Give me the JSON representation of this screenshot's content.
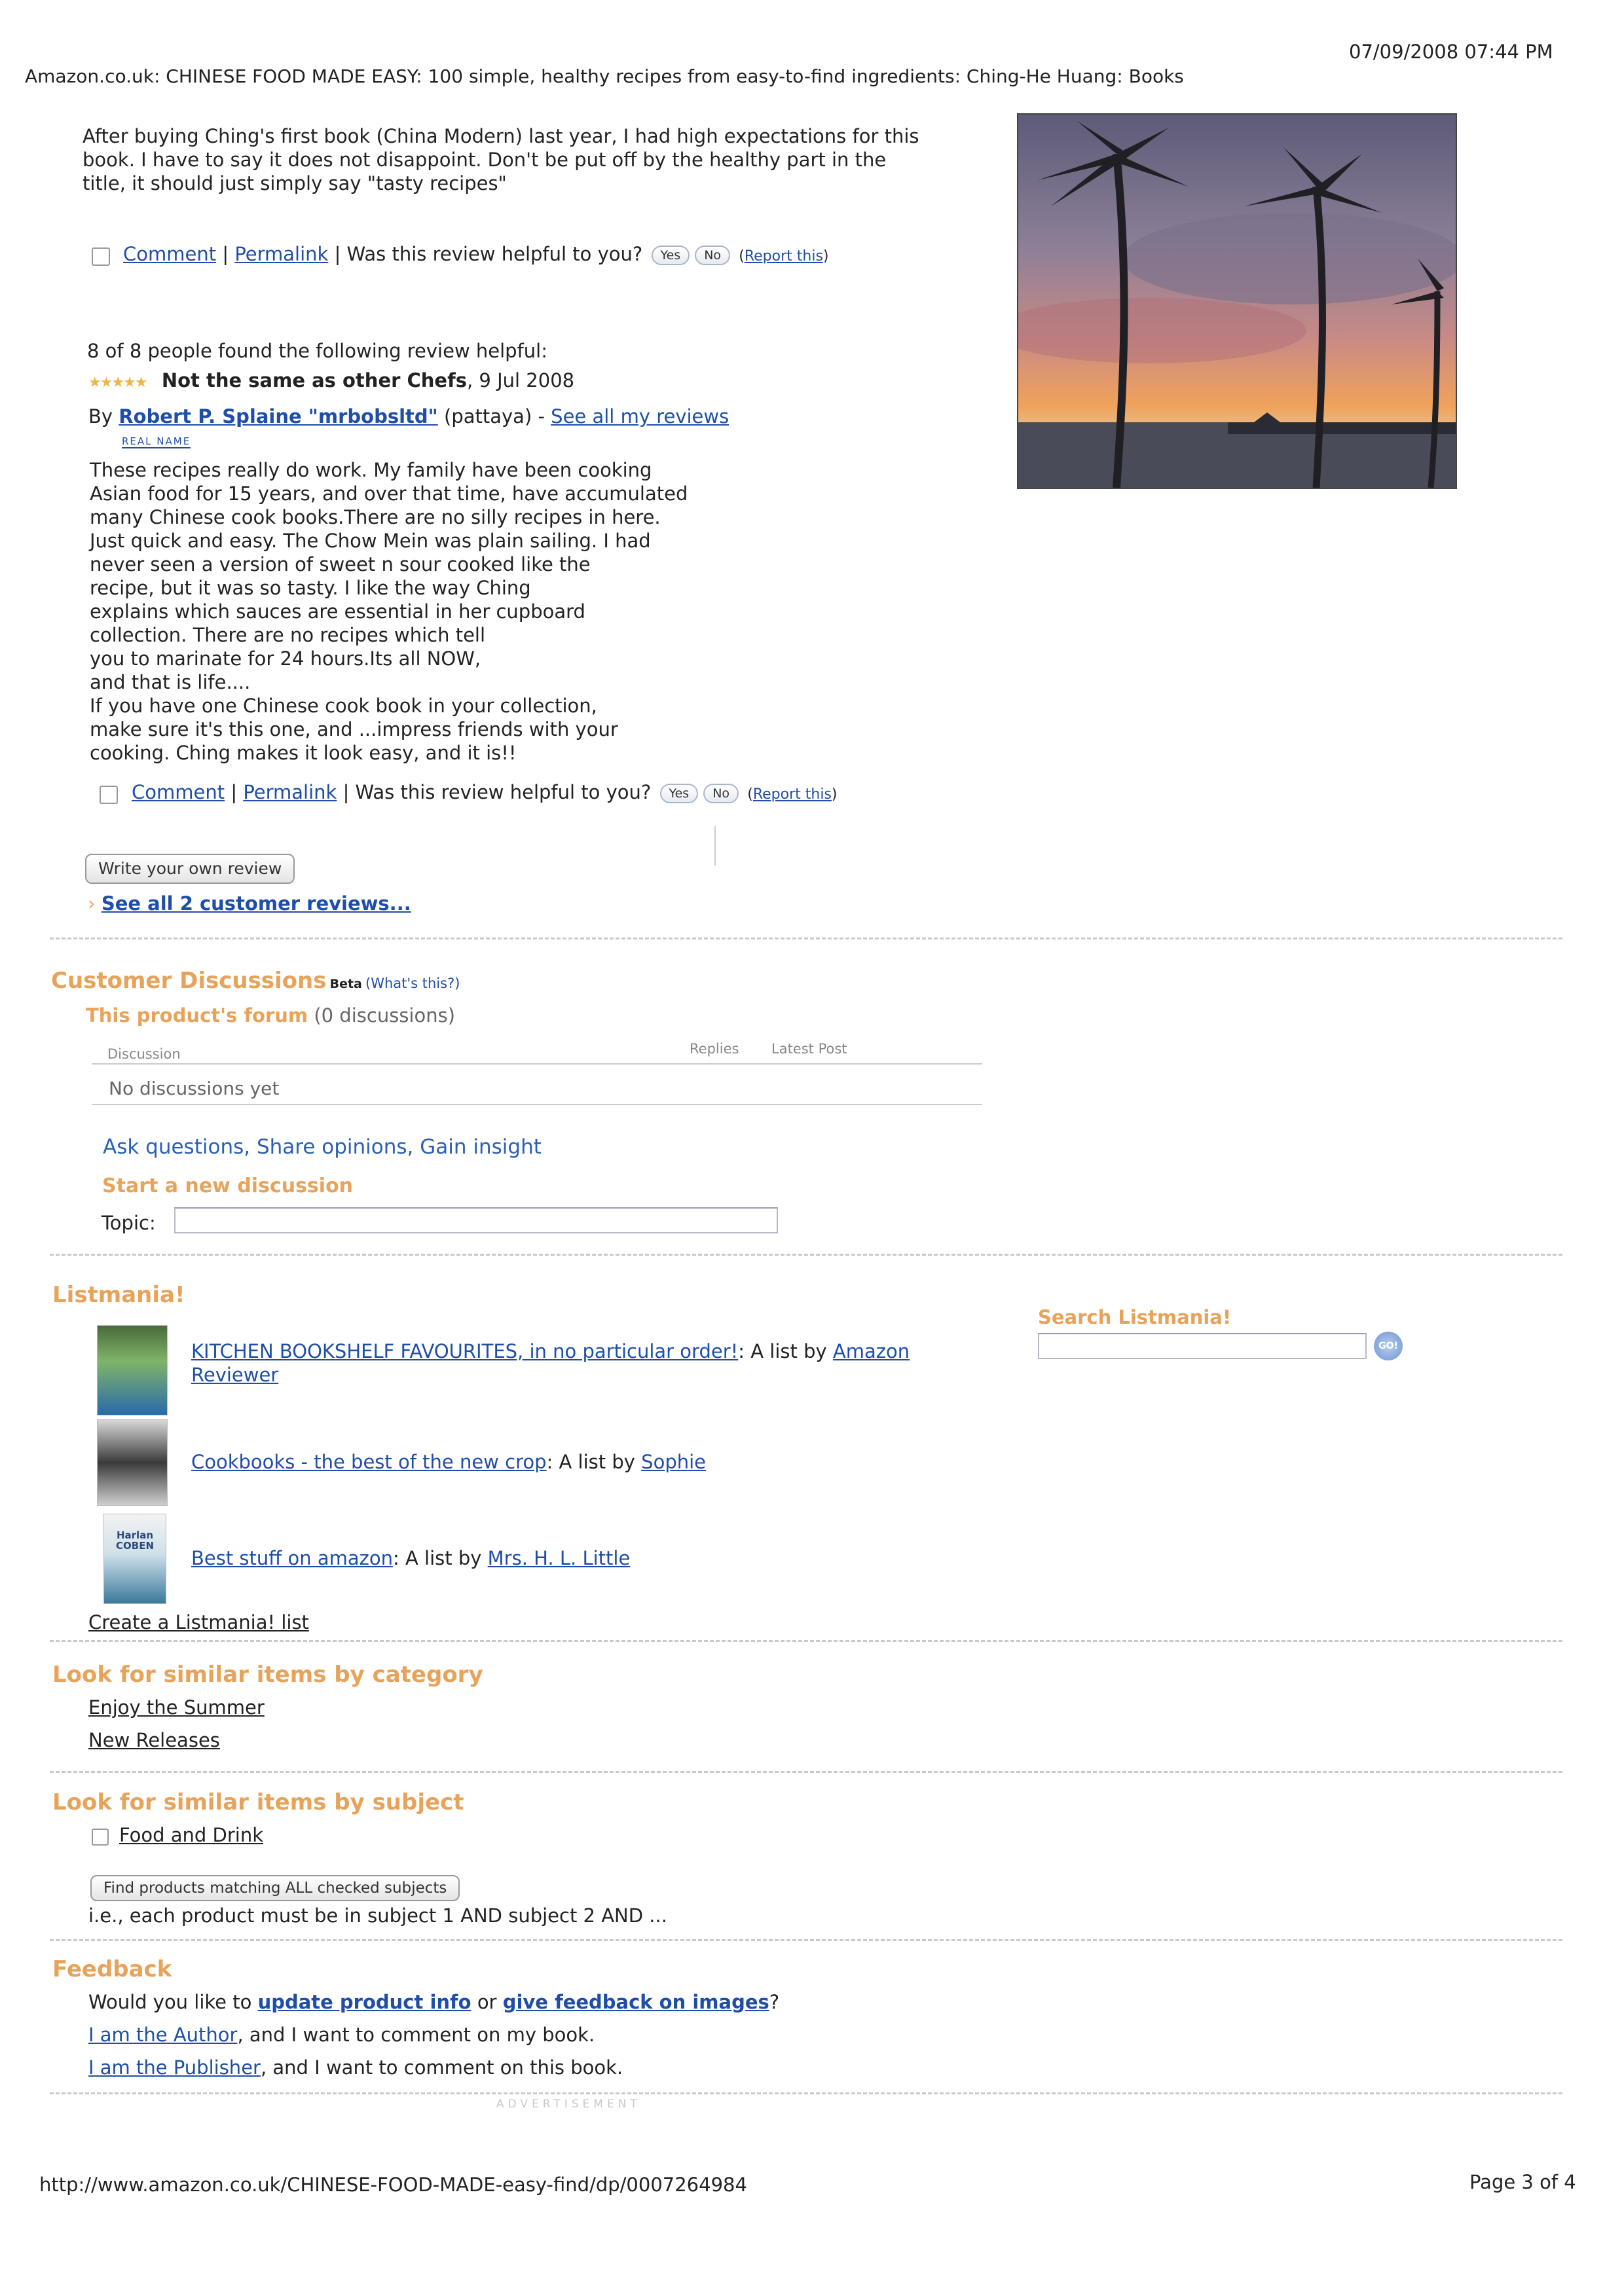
{
  "header": {
    "title": "Amazon.co.uk: CHINESE FOOD MADE EASY: 100 simple, healthy recipes from easy-to-find ingredients: Ching-He Huang: Books",
    "datetime": "07/09/2008 07:44 PM"
  },
  "review1": {
    "text_lines": [
      "After buying Ching's first book (China Modern) last year, I had high expectations for this",
      "book. I have to say it does not disappoint. Don't be put off by the healthy part in the",
      "title, it should just simply say \"tasty recipes\""
    ],
    "comment": "Comment",
    "sep1": "|",
    "permalink": "Permalink",
    "question": "| Was this review helpful to you?",
    "yes": "Yes",
    "no": "No",
    "report_open": "(",
    "report": "Report this",
    "report_close": ")"
  },
  "review2": {
    "helpful": "8 of 8 people found the following review helpful:",
    "stars": "★★★★★",
    "title": "Not the same as other Chefs",
    "date": ", 9 Jul 2008",
    "by": "By",
    "author": "Robert P. Splaine \"mrbobsltd\"",
    "location": "(pattaya) -",
    "see_all": "See all my reviews",
    "real_name": "REAL NAME",
    "text_lines": [
      "These recipes really do work. My family have been cooking",
      "Asian food for 15 years, and over that time, have accumulated",
      "many Chinese cook books.There are no silly recipes in here.",
      "Just quick and easy. The Chow Mein was plain sailing. I had",
      "never seen a version of sweet n sour cooked like the",
      "recipe, but it was so tasty. I like the way Ching",
      "explains which sauces are essential in her cupboard",
      "collection. There are no recipes which tell",
      "you to marinate for 24 hours.Its all NOW,",
      "and that is life....",
      "If you have one Chinese cook book in your collection,",
      "make sure it's this one, and ...impress friends with your",
      "cooking. Ching makes it look easy, and it is!!"
    ],
    "comment": "Comment",
    "sep1": "|",
    "permalink": "Permalink",
    "question": "| Was this review helpful to you?",
    "yes": "Yes",
    "no": "No",
    "report_open": "(",
    "report": "Report this",
    "report_close": ")"
  },
  "write_review": "Write your own review",
  "see_all_reviews_arrow": "›",
  "see_all_reviews": "See all 2 customer reviews...",
  "discussions": {
    "heading": "Customer Discussions",
    "beta": "Beta",
    "whats_this_open": "(",
    "whats_this": "What's this?",
    "whats_this_close": ")",
    "forum": "This product's forum",
    "forum_count": "(0 discussions)",
    "col_discussion": "Discussion",
    "col_replies": "Replies",
    "col_latest": "Latest Post",
    "empty": "No discussions yet",
    "ask": "Ask questions, Share opinions, Gain insight",
    "start": "Start a new discussion",
    "topic_label": "Topic:"
  },
  "listmania": {
    "heading": "Listmania!",
    "search_heading": "Search Listmania!",
    "go": "GO!",
    "lists": [
      {
        "title": "KITCHEN BOOKSHELF FAVOURITES, in no particular order!",
        "by": ": A list by",
        "author": "Amazon",
        "author2": "Reviewer"
      },
      {
        "title": "Cookbooks - the best of the new crop",
        "by": ": A list by",
        "author": "Sophie"
      },
      {
        "title": "Best stuff on amazon",
        "by": ": A list by",
        "author": "Mrs. H. L. Little"
      }
    ],
    "thumb3_text": "Harlan COBEN",
    "create": "Create a Listmania! list"
  },
  "similar_category": {
    "heading": "Look for similar items by category",
    "items": [
      "Enjoy the Summer",
      "New Releases"
    ]
  },
  "similar_subject": {
    "heading": "Look for similar items by subject",
    "item": "Food and Drink",
    "button": "Find products matching ALL checked subjects",
    "note": "i.e., each product must be in subject 1 AND subject 2 AND ..."
  },
  "feedback": {
    "heading": "Feedback",
    "line1_pre": "Would you like to",
    "update": "update product info",
    "or": "or",
    "give": "give feedback on images",
    "q": "?",
    "author_link": "I am the Author",
    "author_rest": ", and I want to comment on my book.",
    "publisher_link": "I am the Publisher",
    "publisher_rest": ", and I want to comment on this book."
  },
  "advertisement": "ADVERTISEMENT",
  "footer": {
    "url": "http://www.amazon.co.uk/CHINESE-FOOD-MADE-easy-find/dp/0007264984",
    "page": "Page 3 of 4"
  }
}
